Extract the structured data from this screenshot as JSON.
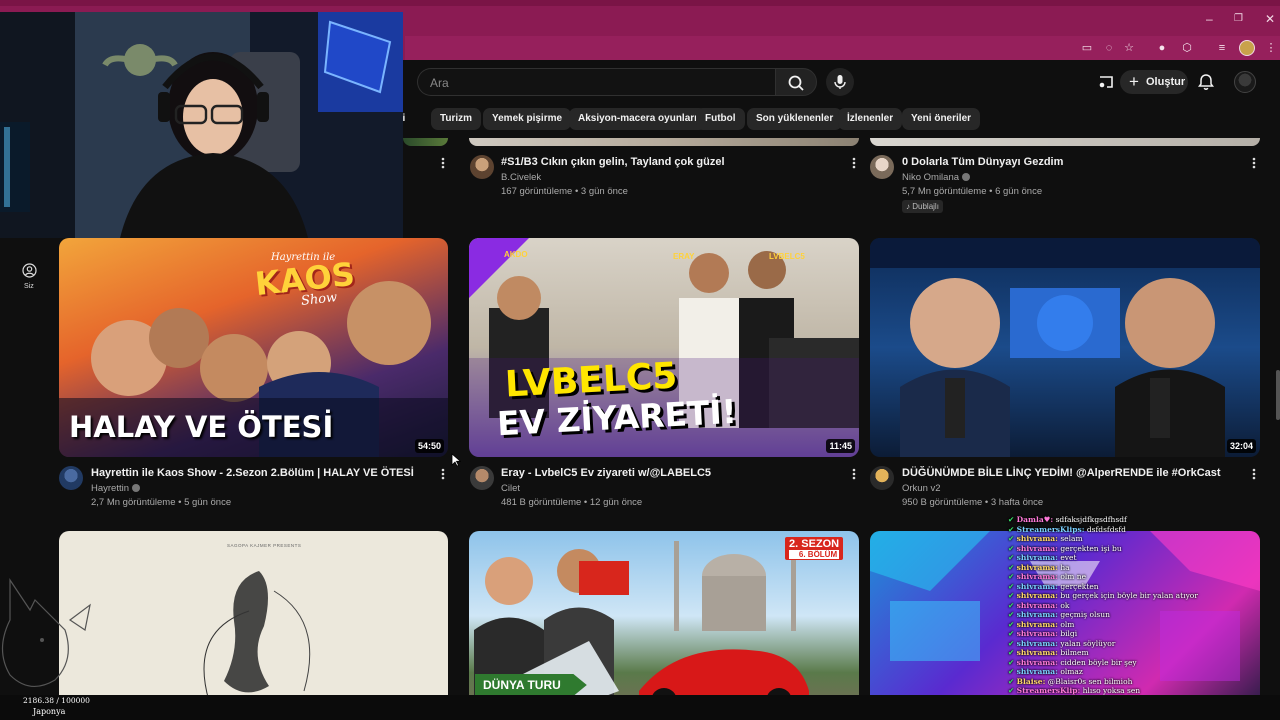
{
  "window": {
    "minimize": "–",
    "maximize": "❐",
    "close": "✕"
  },
  "search": {
    "placeholder": "Ara"
  },
  "header": {
    "create_label": "Oluştur"
  },
  "chips": [
    "eri",
    "Turizm",
    "Yemek pişirme",
    "Aksiyon-macera oyunları",
    "Futbol",
    "Son yüklenenler",
    "İzlenenler",
    "Yeni öneriler"
  ],
  "nav": {
    "siz_label": "Siz"
  },
  "top_row": [
    {
      "title": "#S1/B3 Cıkın çıkın gelin, Tayland çok güzel",
      "channel": "B.Civelek",
      "meta": "167 görüntüleme • 3 gün önce"
    },
    {
      "title": "0 Dolarla Tüm Dünyayı Gezdim",
      "channel": "Niko Omilana",
      "meta": "5,7 Mn görüntüleme • 6 gün önce",
      "badge": "Dublajlı"
    }
  ],
  "videos": [
    {
      "title": "Hayrettin ile Kaos Show - 2.Sezon 2.Bölüm | HALAY VE ÖTESİ",
      "channel": "Hayrettin",
      "meta": "2,7 Mn görüntüleme • 5 gün önce",
      "duration": "54:50",
      "overlay_big": "HALAY VE ÖTESİ",
      "overlay_logo_top": "Hayrettin ile",
      "overlay_logo": "KAOS",
      "overlay_logo_sub": "Show"
    },
    {
      "title": "Eray - LvbelC5 Ev ziyareti w/@LABELC5",
      "channel": "Cilet",
      "meta": "481 B görüntüleme • 12 gün önce",
      "duration": "11:45",
      "overlay_line1": "LVBELC5",
      "overlay_line2": "EV ZİYARETİ!",
      "tag_akdo": "AKDO",
      "tag_eray": "ERAY",
      "tag_lvbelc5": "LVBELC5"
    },
    {
      "title": "DÜĞÜNÜMDE BİLE LİNÇ YEDİM! @AlperRENDE  ile #OrkCast",
      "channel": "Orkun v2",
      "meta": "950 B görüntüleme • 3 hafta önce",
      "duration": "32:04"
    }
  ],
  "bottom_row": [
    {
      "overlay_small": "SAGOPA KAJMER PRESENTS"
    },
    {
      "badge_line1": "2. SEZON",
      "badge_line2": "6. BÖLÜM",
      "overlay_tag": "DÜNYA TURU"
    },
    {}
  ],
  "chat": [
    {
      "user": "Damla♥:",
      "msg": "sdfaksjdfkgsdfhsdf"
    },
    {
      "user": "StreamersKlips:",
      "msg": "dsfdsfdsfd"
    },
    {
      "user": "shivrama:",
      "msg": "selam"
    },
    {
      "user": "shivrama:",
      "msg": "gerçekten işi bu"
    },
    {
      "user": "shivrama:",
      "msg": "evet"
    },
    {
      "user": "shivrama:",
      "msg": "ha"
    },
    {
      "user": "shivrama:",
      "msg": "olm ne"
    },
    {
      "user": "shivrama:",
      "msg": "gerçekten"
    },
    {
      "user": "shivrama:",
      "msg": "bu gerçek için böyle bir yalan atıyor"
    },
    {
      "user": "shivrama:",
      "msg": "ok"
    },
    {
      "user": "shivrama:",
      "msg": "geçmiş olsun"
    },
    {
      "user": "shivrama:",
      "msg": "olm"
    },
    {
      "user": "shivrama:",
      "msg": "bilgi"
    },
    {
      "user": "shivrama:",
      "msg": "yalan söylüyor"
    },
    {
      "user": "shivrama:",
      "msg": "bilmem"
    },
    {
      "user": "shivrama:",
      "msg": "cidden böyle bir şey"
    },
    {
      "user": "shivrama:",
      "msg": "olmaz"
    },
    {
      "user": "Blaise:",
      "msg": "@Blaisr0s sen bilmioh"
    },
    {
      "user": "StreamersKlip:",
      "msg": "hlıso yoksa sen"
    }
  ],
  "overlay": {
    "counter": "2186.38 / 100000",
    "country": "Japonya"
  },
  "colors": {
    "chrome": "#8b1b53",
    "bg": "#0f0f0f",
    "chip": "#272727"
  }
}
